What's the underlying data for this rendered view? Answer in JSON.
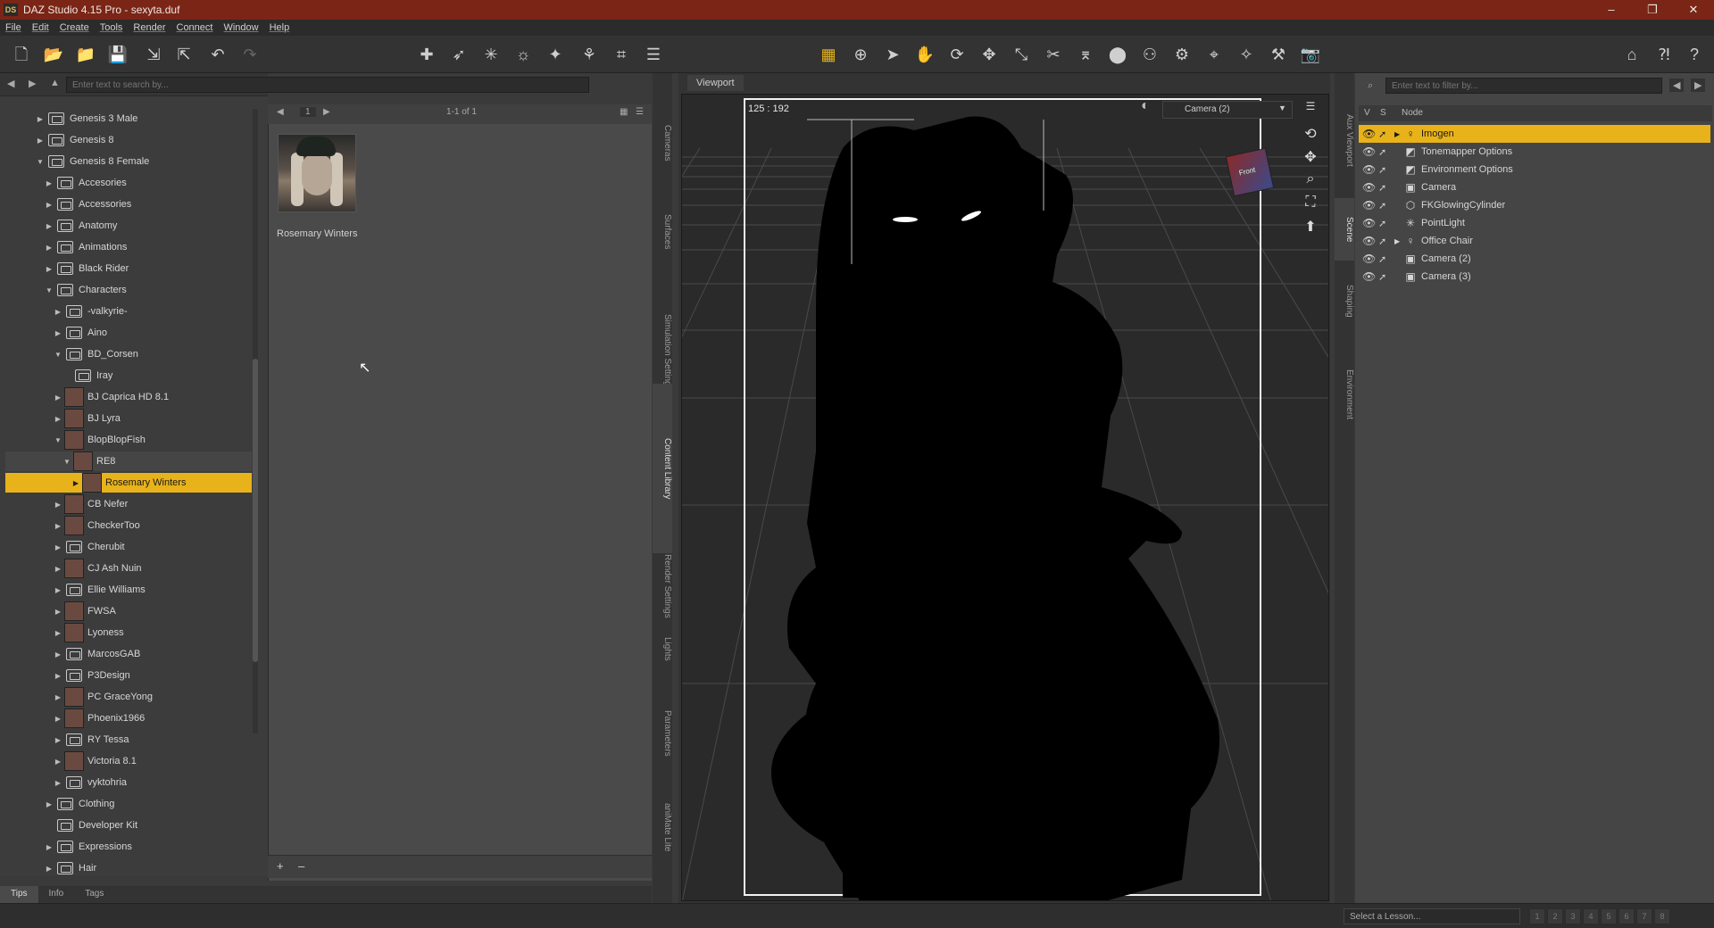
{
  "window": {
    "app_icon": "DS",
    "title": "DAZ Studio 4.15 Pro - sexyta.duf",
    "controls": {
      "minimize": "–",
      "maximize": "❐",
      "close": "✕"
    }
  },
  "menu": [
    "File",
    "Edit",
    "Create",
    "Tools",
    "Render",
    "Connect",
    "Window",
    "Help"
  ],
  "toolbar": {
    "left_icons": [
      "new-icon",
      "open-icon",
      "merge-icon",
      "save-icon",
      "import-icon",
      "export-icon",
      "undo-icon",
      "redo-icon"
    ],
    "tool_icons": [
      "grid-icon",
      "universal-icon",
      "select-icon",
      "node-select-icon",
      "rotate-icon",
      "translate-icon",
      "scale-icon",
      "joint-editor-icon",
      "geometry-editor-icon",
      "surface-selection-icon",
      "posing-icon",
      "spot-render-icon",
      "camera-icon",
      "light-icon",
      "render-icon",
      "render-settings-icon"
    ],
    "right_icons": [
      "daz-home-icon",
      "help-what-icon",
      "help-icon"
    ]
  },
  "library": {
    "search_placeholder": "Enter text to search by...",
    "items": [
      {
        "label": "Genesis 3 Male",
        "indent": 1,
        "arrow": "▶",
        "icon": "folder"
      },
      {
        "label": "Genesis 8",
        "indent": 1,
        "arrow": "▶",
        "icon": "folder"
      },
      {
        "label": "Genesis 8 Female",
        "indent": 1,
        "arrow": "▼",
        "icon": "folder"
      },
      {
        "label": "Accesories",
        "indent": 2,
        "arrow": "▶",
        "icon": "folder"
      },
      {
        "label": "Accessories",
        "indent": 2,
        "arrow": "▶",
        "icon": "folder"
      },
      {
        "label": "Anatomy",
        "indent": 2,
        "arrow": "▶",
        "icon": "folder"
      },
      {
        "label": "Animations",
        "indent": 2,
        "arrow": "▶",
        "icon": "folder"
      },
      {
        "label": "Black Rider",
        "indent": 2,
        "arrow": "▶",
        "icon": "folder"
      },
      {
        "label": "Characters",
        "indent": 2,
        "arrow": "▼",
        "icon": "folder"
      },
      {
        "label": "-valkyrie-",
        "indent": 3,
        "arrow": "▶",
        "icon": "folder"
      },
      {
        "label": "Aino",
        "indent": 3,
        "arrow": "▶",
        "icon": "folder"
      },
      {
        "label": "BD_Corsen",
        "indent": 3,
        "arrow": "▼",
        "icon": "folder"
      },
      {
        "label": "Iray",
        "indent": 4,
        "arrow": "",
        "icon": "folder"
      },
      {
        "label": "BJ Caprica HD 8.1",
        "indent": 3,
        "arrow": "▶",
        "icon": "thumb"
      },
      {
        "label": "BJ Lyra",
        "indent": 3,
        "arrow": "▶",
        "icon": "thumb"
      },
      {
        "label": "BlopBlopFish",
        "indent": 3,
        "arrow": "▼",
        "icon": "thumb"
      },
      {
        "label": "RE8",
        "indent": 4,
        "arrow": "▼",
        "icon": "thumb",
        "sub": true
      },
      {
        "label": "Rosemary Winters",
        "indent": 5,
        "arrow": "▶",
        "icon": "thumb",
        "selected": true
      },
      {
        "label": "CB Nefer",
        "indent": 3,
        "arrow": "▶",
        "icon": "thumb"
      },
      {
        "label": "CheckerToo",
        "indent": 3,
        "arrow": "▶",
        "icon": "thumb"
      },
      {
        "label": "Cherubit",
        "indent": 3,
        "arrow": "▶",
        "icon": "folder"
      },
      {
        "label": "CJ Ash Nuin",
        "indent": 3,
        "arrow": "▶",
        "icon": "thumb"
      },
      {
        "label": "Ellie Williams",
        "indent": 3,
        "arrow": "▶",
        "icon": "folder"
      },
      {
        "label": "FWSA",
        "indent": 3,
        "arrow": "▶",
        "icon": "thumb"
      },
      {
        "label": "Lyoness",
        "indent": 3,
        "arrow": "▶",
        "icon": "thumb"
      },
      {
        "label": "MarcosGAB",
        "indent": 3,
        "arrow": "▶",
        "icon": "folder"
      },
      {
        "label": "P3Design",
        "indent": 3,
        "arrow": "▶",
        "icon": "folder"
      },
      {
        "label": "PC GraceYong",
        "indent": 3,
        "arrow": "▶",
        "icon": "thumb"
      },
      {
        "label": "Phoenix1966",
        "indent": 3,
        "arrow": "▶",
        "icon": "thumb"
      },
      {
        "label": "RY Tessa",
        "indent": 3,
        "arrow": "▶",
        "icon": "folder"
      },
      {
        "label": "Victoria 8.1",
        "indent": 3,
        "arrow": "▶",
        "icon": "thumb"
      },
      {
        "label": "vyktohria",
        "indent": 3,
        "arrow": "▶",
        "icon": "folder"
      },
      {
        "label": "Clothing",
        "indent": 2,
        "arrow": "▶",
        "icon": "folder"
      },
      {
        "label": "Developer Kit",
        "indent": 2,
        "arrow": "",
        "icon": "folder"
      },
      {
        "label": "Expressions",
        "indent": 2,
        "arrow": "▶",
        "icon": "folder"
      },
      {
        "label": "Hair",
        "indent": 2,
        "arrow": "▶",
        "icon": "folder"
      }
    ],
    "bottom_tabs": [
      "Tips",
      "Info",
      "Tags"
    ]
  },
  "content": {
    "page_number": "1",
    "page_range": "1-1 of 1",
    "item_label": "Rosemary Winters",
    "add_label": "+",
    "remove_label": "–"
  },
  "side_tabs_left": [
    "Cameras",
    "Surfaces",
    "Simulation Settings",
    "Content Library",
    "Render Settings",
    "Lights",
    "Parameters",
    "aniMate Lite"
  ],
  "viewport": {
    "tab_label": "Viewport",
    "resolution": "125 : 192",
    "camera": "Camera (2)",
    "cube_label": "Front"
  },
  "side_tabs_right": [
    "Aux Viewport",
    "Scene",
    "Shaping",
    "Environment"
  ],
  "scene": {
    "filter_placeholder": "Enter text to filter by...",
    "col_v": "V",
    "col_s": "S",
    "col_node": "Node",
    "nodes": [
      {
        "label": "Imogen",
        "icon": "figure-icon",
        "glyph": "♀",
        "expand": "▶",
        "selected": true
      },
      {
        "label": "Tonemapper Options",
        "icon": "tonemapper-icon",
        "glyph": "◩",
        "expand": ""
      },
      {
        "label": "Environment Options",
        "icon": "environment-icon",
        "glyph": "◩",
        "expand": ""
      },
      {
        "label": "Camera",
        "icon": "camera-icon",
        "glyph": "▣",
        "expand": ""
      },
      {
        "label": "FKGlowingCylinder",
        "icon": "cylinder-icon",
        "glyph": "⬡",
        "expand": ""
      },
      {
        "label": "PointLight",
        "icon": "light-icon",
        "glyph": "✳",
        "expand": ""
      },
      {
        "label": "Office Chair",
        "icon": "figure-icon",
        "glyph": "♀",
        "expand": "▶"
      },
      {
        "label": "Camera (2)",
        "icon": "camera-icon",
        "glyph": "▣",
        "expand": ""
      },
      {
        "label": "Camera (3)",
        "icon": "camera-icon",
        "glyph": "▣",
        "expand": ""
      }
    ]
  },
  "status": {
    "lesson_placeholder": "Select a Lesson...",
    "lesson_pages": [
      "1",
      "2",
      "3",
      "4",
      "5",
      "6",
      "7",
      "8"
    ]
  }
}
